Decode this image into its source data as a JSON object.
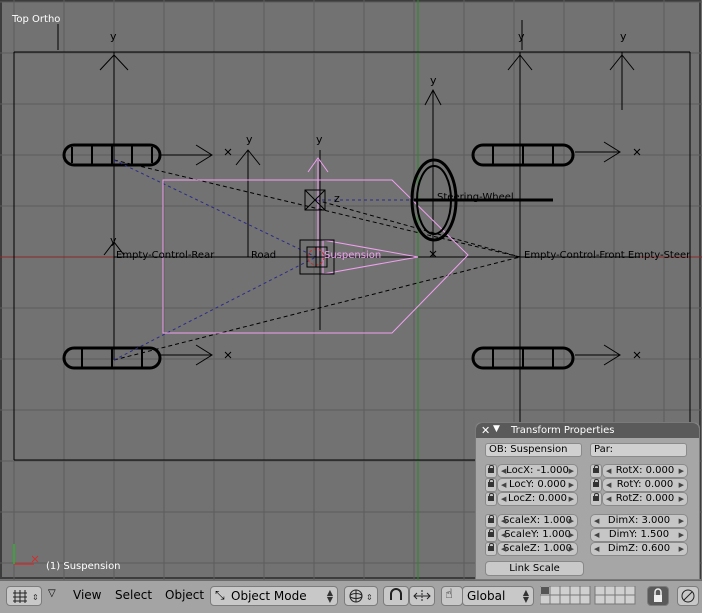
{
  "viewport": {
    "view_label": "Top Ortho",
    "frame_label": "(1) Suspension",
    "axis_label_y": "y",
    "axis_label_z": "z",
    "objects": {
      "empty_control_rear": "Empty-Control-Rear",
      "road": "Road",
      "suspension": "Suspension",
      "steering_wheel": "Steering-Wheel",
      "empty_steer": "Empty-Control-Front Empty-Steer"
    },
    "colors": {
      "background": "#727272",
      "grid": "#5e5e5e",
      "selected": "#f0a0f0",
      "wire": "#000000"
    }
  },
  "transform_panel": {
    "title": "Transform Properties",
    "ob": "OB: Suspension",
    "par": "Par:",
    "loc": [
      {
        "label": "LocX: -1.000"
      },
      {
        "label": "LocY: 0.000"
      },
      {
        "label": "LocZ: 0.000"
      }
    ],
    "rot": [
      {
        "label": "RotX: 0.000"
      },
      {
        "label": "RotY: 0.000"
      },
      {
        "label": "RotZ: 0.000"
      }
    ],
    "scale": [
      {
        "label": "ScaleX: 1.000"
      },
      {
        "label": "ScaleY: 1.000"
      },
      {
        "label": "ScaleZ: 1.000"
      }
    ],
    "dim": [
      {
        "label": "DimX: 3.000"
      },
      {
        "label": "DimY: 1.500"
      },
      {
        "label": "DimZ: 0.600"
      }
    ],
    "link_scale": "Link Scale"
  },
  "header": {
    "menus": {
      "view": "View",
      "select": "Select",
      "object": "Object"
    },
    "mode": "Object Mode",
    "orientation": "Global",
    "icons": [
      "grid-icon",
      "triangle-icon",
      "sphere-icon",
      "magnet-icon",
      "arrows-icon",
      "hand-icon",
      "lock-icon",
      "render-icon"
    ]
  }
}
